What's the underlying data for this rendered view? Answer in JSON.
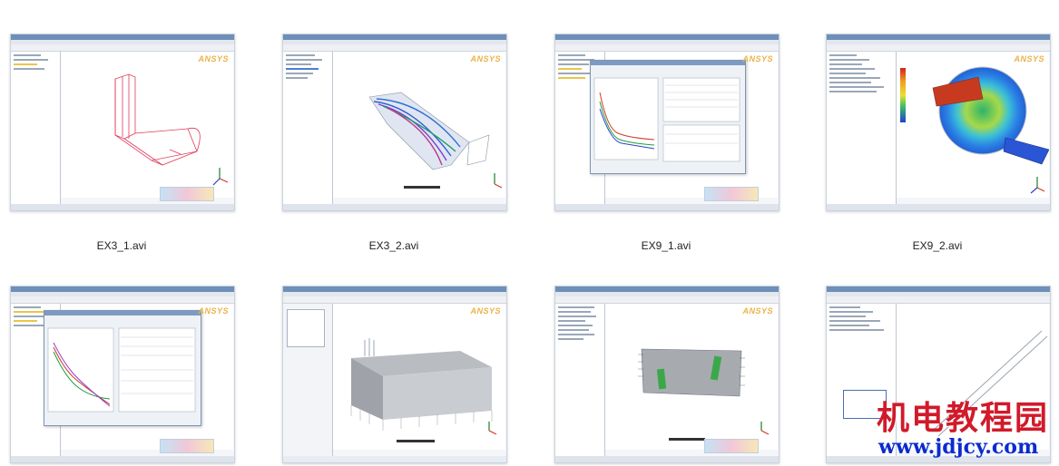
{
  "thumbnails": [
    {
      "caption": "EX3_1.avi",
      "view": "pipe-wireframe"
    },
    {
      "caption": "EX3_2.avi",
      "view": "flow-streamlines"
    },
    {
      "caption": "EX9_1.avi",
      "view": "convergence-plot"
    },
    {
      "caption": "EX9_2.avi",
      "view": "temperature-contour"
    },
    {
      "caption": "",
      "view": "convergence-plot-2"
    },
    {
      "caption": "",
      "view": "mesh-block"
    },
    {
      "caption": "",
      "view": "plate-mesh"
    },
    {
      "caption": "",
      "view": "pipe-dropdown"
    }
  ],
  "app_logo_text": "ANSYS",
  "watermark": {
    "title": "机电教程园",
    "url": "www.jdjcy.com",
    "title_color": "#d11a2a",
    "url_color": "#0b2bd0"
  },
  "colors": {
    "titlebar": "#6d8fb8",
    "wireframe": "#e03a5a",
    "accent_orange": "#e9b34b"
  }
}
